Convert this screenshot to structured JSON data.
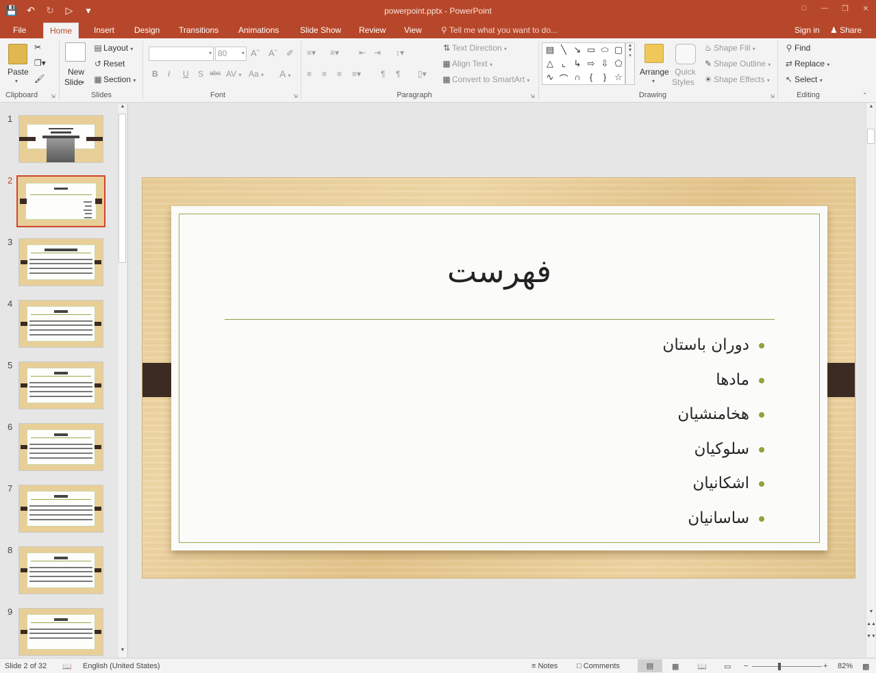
{
  "window": {
    "title": "powerpoint.pptx - PowerPoint",
    "controls": [
      "ribbon-display",
      "minimize",
      "restore",
      "close"
    ]
  },
  "qat": {
    "icons": [
      "save-icon",
      "undo-icon",
      "redo-icon",
      "from-beginning-icon",
      "customize-icon"
    ]
  },
  "tabs": [
    "File",
    "Home",
    "Insert",
    "Design",
    "Transitions",
    "Animations",
    "Slide Show",
    "Review",
    "View"
  ],
  "active_tab": "Home",
  "tell_me": "Tell me what you want to do...",
  "sign_in": "Sign in",
  "share": "Share",
  "ribbon": {
    "clipboard": {
      "label": "Clipboard",
      "paste": "Paste"
    },
    "slides": {
      "label": "Slides",
      "new_slide_1": "New",
      "new_slide_2": "Slide",
      "layout": "Layout",
      "reset": "Reset",
      "section": "Section"
    },
    "font": {
      "label": "Font",
      "size": "80",
      "bold": "B",
      "italic": "I",
      "underline": "U",
      "shadow": "S",
      "strike": "abc",
      "spacing": "AV",
      "case": "Aa",
      "color": "A"
    },
    "paragraph": {
      "label": "Paragraph",
      "text_direction": "Text Direction",
      "align_text": "Align Text",
      "smartart": "Convert to SmartArt"
    },
    "drawing": {
      "label": "Drawing",
      "arrange": "Arrange",
      "quick_1": "Quick",
      "quick_2": "Styles",
      "shape_fill": "Shape Fill",
      "shape_outline": "Shape Outline",
      "shape_effects": "Shape Effects"
    },
    "editing": {
      "label": "Editing",
      "find": "Find",
      "replace": "Replace",
      "select": "Select"
    }
  },
  "thumbnails": [
    {
      "num": "1"
    },
    {
      "num": "2"
    },
    {
      "num": "3"
    },
    {
      "num": "4"
    },
    {
      "num": "5"
    },
    {
      "num": "6"
    },
    {
      "num": "7"
    },
    {
      "num": "8"
    },
    {
      "num": "9"
    }
  ],
  "selected_slide": "2",
  "slide": {
    "title": "فهرست",
    "bullets": [
      "دوران باستان",
      "مادها",
      "هخامنشیان",
      "سلوکیان",
      "اشکانیان",
      "ساسانیان"
    ]
  },
  "status": {
    "slide_info": "Slide 2 of 32",
    "language": "English (United States)",
    "notes": "Notes",
    "comments": "Comments",
    "zoom": "82%"
  }
}
